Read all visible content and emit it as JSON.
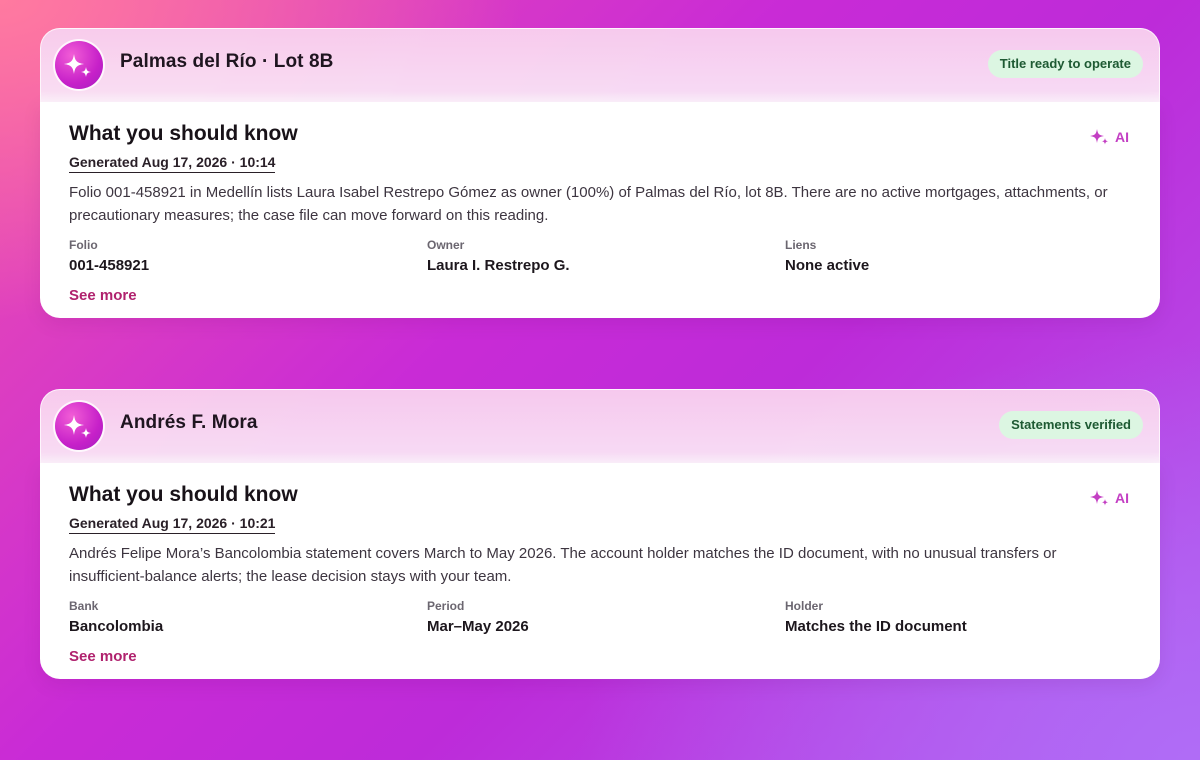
{
  "cards": [
    {
      "title": "Palmas del Río · Lot 8B",
      "status": "Title ready to operate",
      "section_title": "What you should know",
      "ai_label": "AI",
      "generated": "Generated Aug 17, 2026 · 10:14",
      "summary": "Folio 001-458921 in Medellín lists Laura Isabel Restrepo Gómez as owner (100%) of Palmas del Río, lot 8B. There are no active mortgages, attachments, or precautionary measures; the case file can move forward on this reading.",
      "fields": [
        {
          "label": "Folio",
          "value": "001-458921"
        },
        {
          "label": "Owner",
          "value": "Laura I. Restrepo G."
        },
        {
          "label": "Liens",
          "value": "None active"
        }
      ],
      "see_more": "See more"
    },
    {
      "title": "Andrés F. Mora",
      "status": "Statements verified",
      "section_title": "What you should know",
      "ai_label": "AI",
      "generated": "Generated Aug 17, 2026 · 10:21",
      "summary": "Andrés Felipe Mora’s Bancolombia statement covers March to May 2026. The account holder matches the ID document, with no unusual transfers or insufficient-balance alerts; the lease decision stays with your team.",
      "fields": [
        {
          "label": "Bank",
          "value": "Bancolombia"
        },
        {
          "label": "Period",
          "value": "Mar–May 2026"
        },
        {
          "label": "Holder",
          "value": "Matches the ID document"
        }
      ],
      "see_more": "See more"
    }
  ],
  "icons": {
    "avatar": "sparkles-icon",
    "ai": "sparkles-icon"
  },
  "colors": {
    "accent": "#b0226e",
    "status_bg": "#dcf6e2",
    "status_text": "#1e5a33",
    "ai": "#c33fc3"
  }
}
